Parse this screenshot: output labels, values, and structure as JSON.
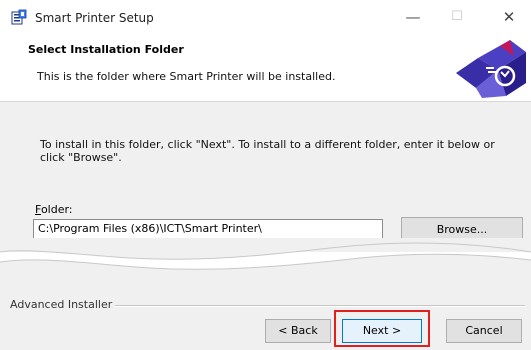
{
  "window": {
    "title": "Smart Printer Setup",
    "controls": {
      "minimize": "—",
      "maximize": "☐",
      "close": "✕"
    }
  },
  "header": {
    "title": "Select Installation Folder",
    "subtitle": "This is the folder where Smart Printer will be installed."
  },
  "body": {
    "instruction": "To install in this folder, click \"Next\". To install to a different folder, enter it below or click \"Browse\".",
    "folder_label_prefix": "F",
    "folder_label_rest": "older:",
    "folder_value": "C:\\Program Files (x86)\\ICT\\Smart Printer\\",
    "browse_label": "Browse..."
  },
  "footer": {
    "brand": "Advanced Installer",
    "back_label": "< Back",
    "next_label": "Next >",
    "cancel_label": "Cancel"
  },
  "colors": {
    "accent": "#0078d7",
    "highlight": "#e02020",
    "logo_primary": "#3a2ea8",
    "logo_secondary": "#c2185b"
  },
  "icons": {
    "app": "installer-icon",
    "logo": "smart-printer-logo"
  }
}
